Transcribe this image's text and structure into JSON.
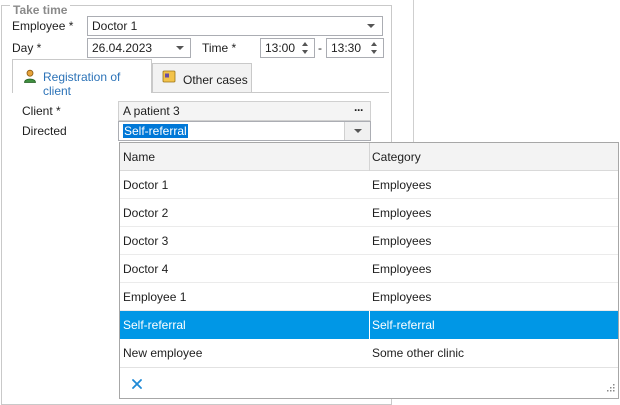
{
  "group": {
    "title": "Take time"
  },
  "employee": {
    "label": "Employee *",
    "value": "Doctor 1"
  },
  "day": {
    "label": "Day *",
    "value": "26.04.2023"
  },
  "time": {
    "label": "Time *",
    "start": "13:00",
    "separator": "-",
    "end": "13:30"
  },
  "tabs": [
    {
      "label": "Registration of client",
      "active": true,
      "icon": "person-icon"
    },
    {
      "label": "Other cases",
      "active": false,
      "icon": "cases-icon"
    }
  ],
  "client": {
    "label": "Client *",
    "value": "A patient 3",
    "more": "···"
  },
  "directed": {
    "label": "Directed",
    "value": "Self-referral"
  },
  "grid": {
    "columns": [
      "Name",
      "Category"
    ],
    "rows": [
      {
        "name": "Doctor 1",
        "category": "Employees"
      },
      {
        "name": "Doctor 2",
        "category": "Employees"
      },
      {
        "name": "Doctor 3",
        "category": "Employees"
      },
      {
        "name": "Doctor 4",
        "category": "Employees"
      },
      {
        "name": "Employee 1",
        "category": "Employees"
      },
      {
        "name": "Self-referral",
        "category": "Self-referral",
        "selected": true
      },
      {
        "name": "New employee",
        "category": "Some other clinic"
      }
    ],
    "clear_icon": "close-icon",
    "resize_icon": "resize-grip-icon"
  },
  "colors": {
    "selection": "#0097e6",
    "accent": "#2c73b8",
    "clear": "#1f8ad6"
  }
}
